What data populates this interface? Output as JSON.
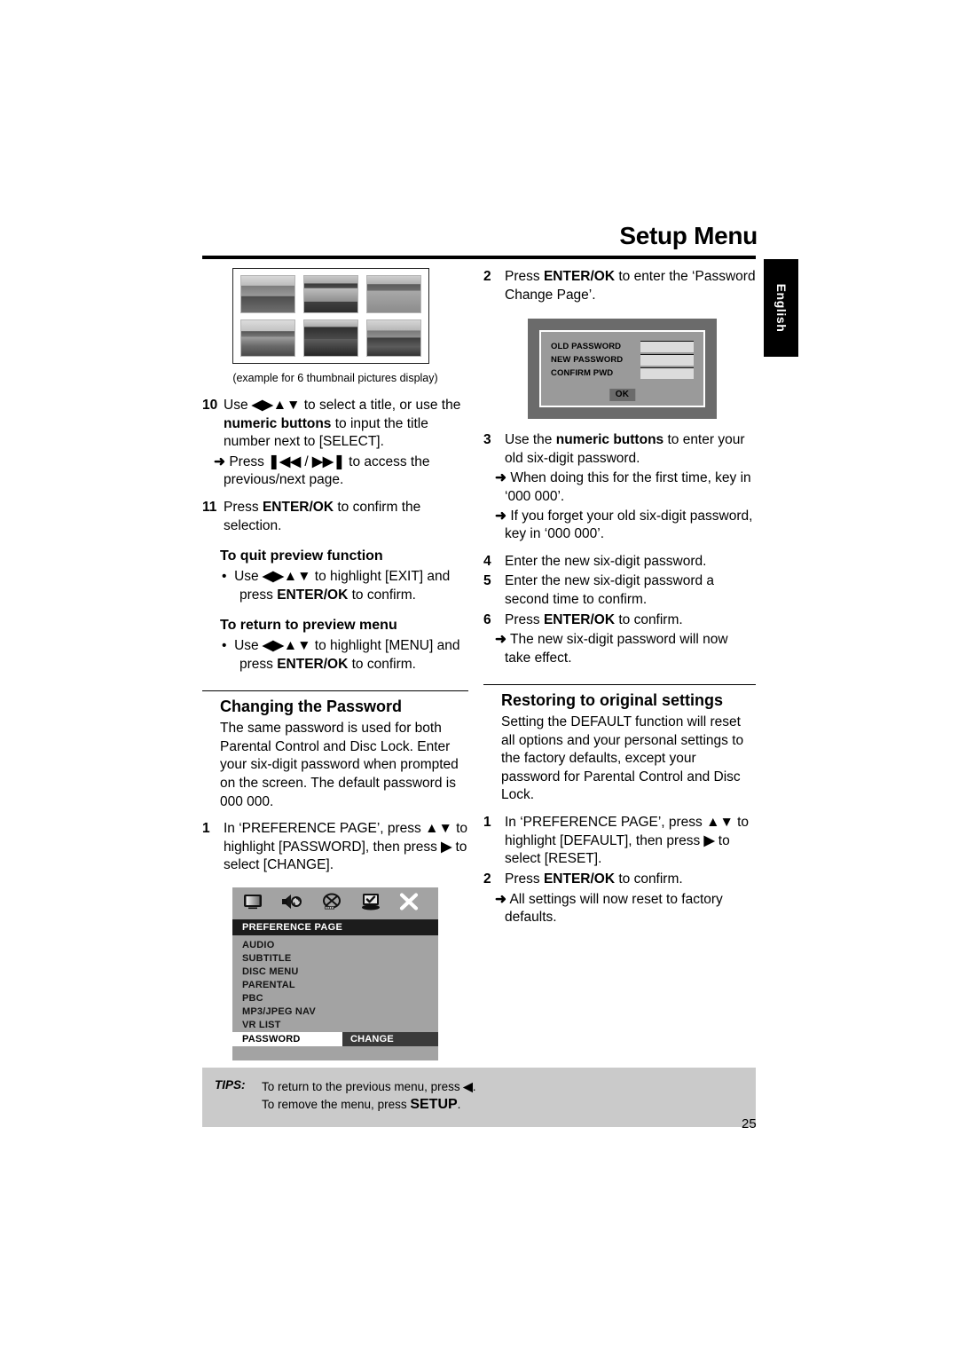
{
  "header": {
    "title": "Setup Menu",
    "language_tab": "English"
  },
  "figure_thumbnails": {
    "caption": "(example for 6 thumbnail pictures display)",
    "count": 6,
    "items": [
      {
        "alt": "landscape-thumbnail-1"
      },
      {
        "alt": "landscape-thumbnail-2"
      },
      {
        "alt": "landscape-thumbnail-3"
      },
      {
        "alt": "landscape-thumbnail-4"
      },
      {
        "alt": "landscape-thumbnail-5"
      },
      {
        "alt": "landscape-thumbnail-6"
      }
    ]
  },
  "left_column": {
    "step10": {
      "number": "10",
      "line1_a": "Use ",
      "line1_arrows": "◀▶▲▼",
      "line1_b": " to select a title, or use the ",
      "line1_bold": "numeric buttons",
      "line1_c": " to input the title number next to [SELECT].",
      "sub1_arrow": "➜",
      "sub1_a": "Press ",
      "sub1_glyph1": "❚◀◀",
      "sub1_mid": " / ",
      "sub1_glyph2": "▶▶❚",
      "sub1_b": " to access the previous/next page."
    },
    "step11": {
      "number": "11",
      "text_a": "Press ",
      "text_bold": "ENTER/OK",
      "text_b": " to confirm the selection."
    },
    "quit_preview": {
      "heading": "To quit preview function",
      "bullet_mark": "•",
      "text_a": "Use ",
      "arrows": "◀▶▲▼",
      "text_b": " to highlight [EXIT] and press ",
      "text_bold": "ENTER/OK",
      "text_c": " to confirm."
    },
    "return_preview": {
      "heading": "To return to preview menu",
      "bullet_mark": "•",
      "text_a": "Use ",
      "arrows": "◀▶▲▼",
      "text_b": " to highlight [MENU] and press ",
      "text_bold": "ENTER/OK",
      "text_c": " to confirm."
    },
    "changing_password": {
      "title": "Changing the Password",
      "paragraph": "The same password is used for both Parental Control and Disc Lock. Enter your six-digit password when prompted on the screen. The default password is 000 000.",
      "step1": {
        "number": "1",
        "text_a": "In ‘PREFERENCE PAGE’, press ",
        "arrows": "▲▼",
        "text_b": " to highlight [PASSWORD], then press ",
        "arrow_right": "▶",
        "text_c": " to select [CHANGE]."
      }
    }
  },
  "preference_osd": {
    "icons": [
      {
        "name": "display-icon"
      },
      {
        "name": "audio-speaker-icon"
      },
      {
        "name": "video-disc-icon"
      },
      {
        "name": "preference-monitor-icon"
      },
      {
        "name": "exit-close-icon"
      }
    ],
    "header": "PREFERENCE PAGE",
    "items": [
      "AUDIO",
      "SUBTITLE",
      "DISC MENU",
      "PARENTAL",
      "PBC",
      "MP3/JPEG NAV",
      "VR LIST"
    ],
    "selected_item": {
      "name": "PASSWORD",
      "value": "CHANGE"
    }
  },
  "right_column": {
    "step2": {
      "number": "2",
      "text_a": "Press ",
      "text_bold": "ENTER/OK",
      "text_b": " to enter the ‘Password Change Page’."
    },
    "step3": {
      "number": "3",
      "text_a": "Use the ",
      "text_bold": "numeric buttons",
      "text_b": " to enter your old six-digit password.",
      "sub1_arrow": "➜",
      "sub1": "When doing this for the first time, key in ‘000 000’.",
      "sub2_arrow": "➜",
      "sub2": "If you forget your old six-digit password, key in ‘000 000’."
    },
    "step4": {
      "number": "4",
      "text": "Enter the new six-digit password."
    },
    "step5": {
      "number": "5",
      "text": "Enter the new six-digit password a second time to confirm."
    },
    "step6": {
      "number": "6",
      "text_a": "Press ",
      "text_bold": "ENTER/OK",
      "text_b": " to confirm.",
      "sub1_arrow": "➜",
      "sub1": "The new six-digit password will now take effect."
    },
    "restoring": {
      "title": "Restoring to original settings",
      "paragraph": "Setting the DEFAULT function will reset all options and your personal settings to the factory defaults, except your password for Parental Control and Disc Lock.",
      "step1": {
        "number": "1",
        "text_a": "In ‘PREFERENCE PAGE’, press ",
        "arrows": "▲▼",
        "text_b": " to highlight [DEFAULT], then press ",
        "arrow_right": "▶",
        "text_c": " to select [RESET]."
      },
      "step2": {
        "number": "2",
        "text_a": "Press ",
        "text_bold": "ENTER/OK",
        "text_b": " to confirm.",
        "sub1_arrow": "➜",
        "sub1": "All settings will now reset to factory defaults."
      }
    }
  },
  "password_osd": {
    "rows": [
      {
        "label": "OLD PASSWORD",
        "value": ""
      },
      {
        "label": "NEW PASSWORD",
        "value": ""
      },
      {
        "label": "CONFIRM PWD",
        "value": ""
      }
    ],
    "ok_button": "OK"
  },
  "tips": {
    "label": "TIPS:",
    "line1_a": "To return to the previous menu, press ",
    "line1_arrow": "◀",
    "line1_b": ".",
    "line2_a": "To remove the menu, press ",
    "line2_bold": "SETUP",
    "line2_b": "."
  },
  "page_number": "25",
  "colors": {
    "osd_dialog_outer": "#6b6b6b",
    "osd_dialog_inner": "#9a9a9a",
    "osd_field": "#dcdcdc",
    "pref_bg": "#a3a3a3",
    "pref_header_bg": "#1c1c1c",
    "tips_bg": "#cacaca",
    "lang_tab_bg": "#000000"
  }
}
